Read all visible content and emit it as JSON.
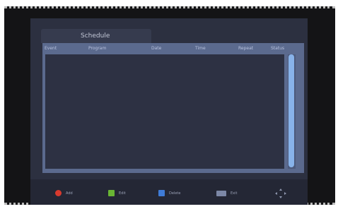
{
  "tab": {
    "title": "Schedule"
  },
  "table": {
    "columns": [
      "Event",
      "Program",
      "Date",
      "Time",
      "Repeat",
      "Status"
    ],
    "rows": []
  },
  "footer": {
    "keys": [
      {
        "label": "Add",
        "color": "#d83a2e",
        "icon": "red-dot-icon"
      },
      {
        "label": "Edit",
        "color": "#69b534",
        "icon": "green-square-icon"
      },
      {
        "label": "Delete",
        "color": "#3f7bd6",
        "icon": "blue-square-icon"
      },
      {
        "label": "Exit",
        "icon": "exit-key-icon"
      }
    ],
    "nav_icon": "navigation-arrows-icon"
  },
  "colors": {
    "window": "#2c3040",
    "table_frame": "#5b6a8e",
    "scroll_thumb": "#88b3ea"
  }
}
